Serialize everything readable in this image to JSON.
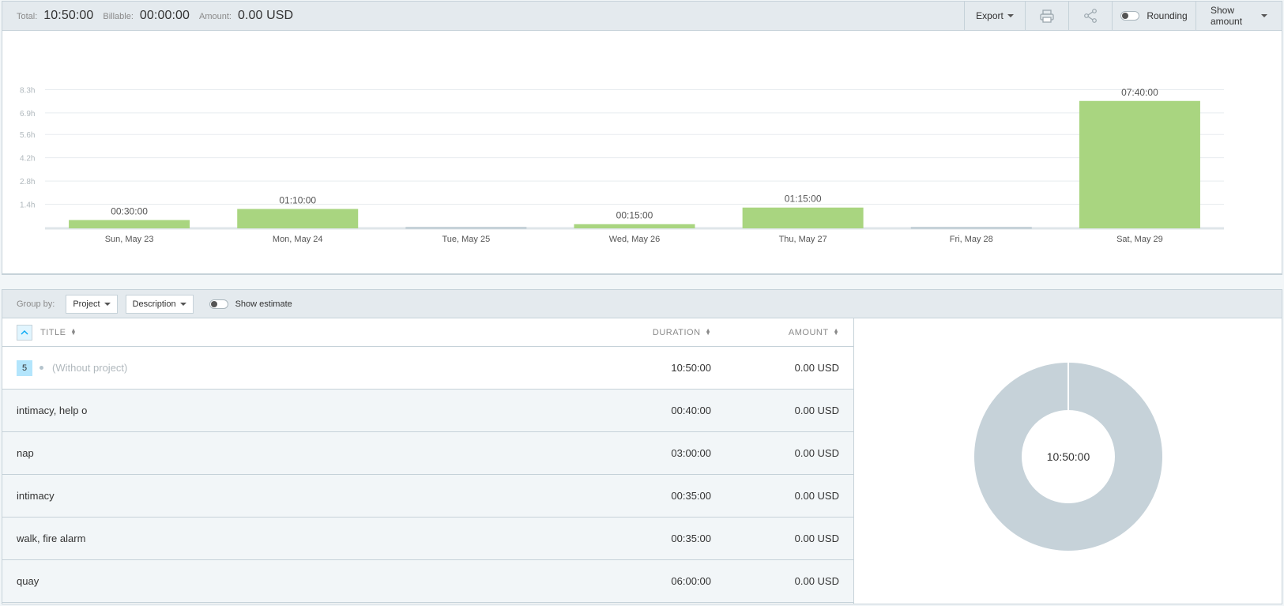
{
  "summary": {
    "total_label": "Total:",
    "total_value": "10:50:00",
    "billable_label": "Billable:",
    "billable_value": "00:00:00",
    "amount_label": "Amount:",
    "amount_value": "0.00 USD"
  },
  "toolbar": {
    "export_label": "Export",
    "print_icon": "printer-icon",
    "share_icon": "share-icon",
    "rounding_label": "Rounding",
    "show_amount_label": "Show amount"
  },
  "chart_data": {
    "type": "bar",
    "title": "",
    "xlabel": "",
    "ylabel": "",
    "y_ticks": [
      "1.4h",
      "2.8h",
      "4.2h",
      "5.6h",
      "6.9h",
      "8.3h"
    ],
    "ylim": [
      0,
      9.7
    ],
    "categories": [
      "Sun, May 23",
      "Mon, May 24",
      "Tue, May 25",
      "Wed, May 26",
      "Thu, May 27",
      "Fri, May 28",
      "Sat, May 29"
    ],
    "values": [
      0.5,
      1.1667,
      0,
      0.25,
      1.25,
      0,
      7.6667
    ],
    "labels": [
      "00:30:00",
      "01:10:00",
      "",
      "00:15:00",
      "01:15:00",
      "",
      "07:40:00"
    ],
    "grid": true,
    "colors": {
      "bar": "#a9d580",
      "empty": "#c6d2d9",
      "grid": "#e8ecef"
    }
  },
  "groupbar": {
    "label": "Group by:",
    "group1": "Project",
    "group2": "Description",
    "show_estimate_label": "Show estimate"
  },
  "table": {
    "headers": {
      "title": "TITLE",
      "duration": "DURATION",
      "amount": "AMOUNT"
    },
    "group": {
      "count": "5",
      "name": "(Without project)",
      "duration": "10:50:00",
      "amount": "0.00 USD"
    },
    "rows": [
      {
        "title": "intimacy, help o",
        "duration": "00:40:00",
        "amount": "0.00 USD"
      },
      {
        "title": "nap",
        "duration": "03:00:00",
        "amount": "0.00 USD"
      },
      {
        "title": "intimacy",
        "duration": "00:35:00",
        "amount": "0.00 USD"
      },
      {
        "title": "walk, fire alarm",
        "duration": "00:35:00",
        "amount": "0.00 USD"
      },
      {
        "title": "quay",
        "duration": "06:00:00",
        "amount": "0.00 USD"
      }
    ]
  },
  "donut": {
    "center_label": "10:50:00",
    "color": "#c6d2d9"
  }
}
